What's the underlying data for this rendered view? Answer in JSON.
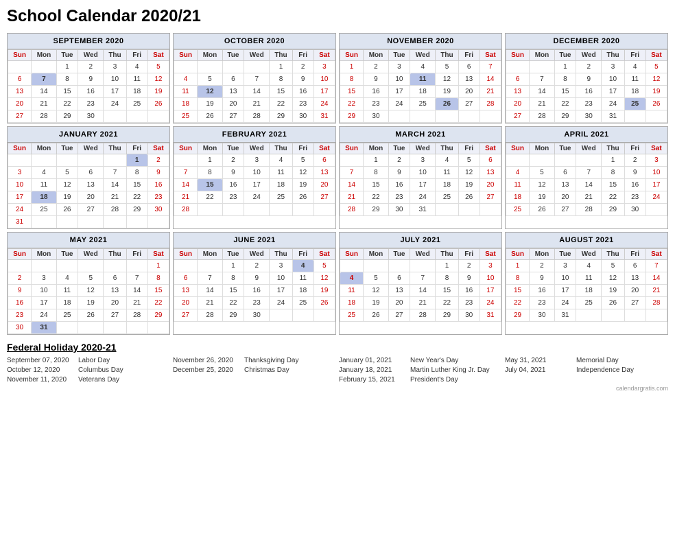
{
  "title": "School Calendar 2020/21",
  "months": [
    {
      "name": "SEPTEMBER 2020",
      "days": [
        "Sun",
        "Mon",
        "Tue",
        "Wed",
        "Thu",
        "Fri",
        "Sat"
      ],
      "weeks": [
        [
          "",
          "",
          "1",
          "2",
          "3",
          "4",
          "5"
        ],
        [
          "6",
          "7",
          "8",
          "9",
          "10",
          "11",
          "12"
        ],
        [
          "13",
          "14",
          "15",
          "16",
          "17",
          "18",
          "19"
        ],
        [
          "20",
          "21",
          "22",
          "23",
          "24",
          "25",
          "26"
        ],
        [
          "27",
          "28",
          "29",
          "30",
          "",
          "",
          ""
        ]
      ],
      "highlights": {
        "7": "blue"
      }
    },
    {
      "name": "OCTOBER 2020",
      "days": [
        "Sun",
        "Mon",
        "Tue",
        "Wed",
        "Thu",
        "Fri",
        "Sat"
      ],
      "weeks": [
        [
          "",
          "",
          "",
          "",
          "1",
          "2",
          "3"
        ],
        [
          "4",
          "5",
          "6",
          "7",
          "8",
          "9",
          "10"
        ],
        [
          "11",
          "12",
          "13",
          "14",
          "15",
          "16",
          "17"
        ],
        [
          "18",
          "19",
          "20",
          "21",
          "22",
          "23",
          "24"
        ],
        [
          "25",
          "26",
          "27",
          "28",
          "29",
          "30",
          "31"
        ]
      ],
      "highlights": {
        "12": "blue"
      }
    },
    {
      "name": "NOVEMBER 2020",
      "days": [
        "Sun",
        "Mon",
        "Tue",
        "Wed",
        "Thu",
        "Fri",
        "Sat"
      ],
      "weeks": [
        [
          "1",
          "2",
          "3",
          "4",
          "5",
          "6",
          "7"
        ],
        [
          "8",
          "9",
          "10",
          "11",
          "12",
          "13",
          "14"
        ],
        [
          "15",
          "16",
          "17",
          "18",
          "19",
          "20",
          "21"
        ],
        [
          "22",
          "23",
          "24",
          "25",
          "26",
          "27",
          "28"
        ],
        [
          "29",
          "30",
          "",
          "",
          "",
          "",
          ""
        ]
      ],
      "highlights": {
        "11": "blue",
        "26": "blue"
      }
    },
    {
      "name": "DECEMBER 2020",
      "days": [
        "Sun",
        "Mon",
        "Tue",
        "Wed",
        "Thu",
        "Fri",
        "Sat"
      ],
      "weeks": [
        [
          "",
          "",
          "1",
          "2",
          "3",
          "4",
          "5"
        ],
        [
          "6",
          "7",
          "8",
          "9",
          "10",
          "11",
          "12"
        ],
        [
          "13",
          "14",
          "15",
          "16",
          "17",
          "18",
          "19"
        ],
        [
          "20",
          "21",
          "22",
          "23",
          "24",
          "25",
          "26"
        ],
        [
          "27",
          "28",
          "29",
          "30",
          "31",
          "",
          ""
        ]
      ],
      "highlights": {
        "25": "blue"
      }
    },
    {
      "name": "JANUARY 2021",
      "days": [
        "Sun",
        "Mon",
        "Tue",
        "Wed",
        "Thu",
        "Fri",
        "Sat"
      ],
      "weeks": [
        [
          "",
          "",
          "",
          "",
          "",
          "1",
          "2"
        ],
        [
          "3",
          "4",
          "5",
          "6",
          "7",
          "8",
          "9"
        ],
        [
          "10",
          "11",
          "12",
          "13",
          "14",
          "15",
          "16"
        ],
        [
          "17",
          "18",
          "19",
          "20",
          "21",
          "22",
          "23"
        ],
        [
          "24",
          "25",
          "26",
          "27",
          "28",
          "29",
          "30"
        ],
        [
          "31",
          "",
          "",
          "",
          "",
          "",
          ""
        ]
      ],
      "highlights": {
        "1": "blue",
        "18": "blue"
      }
    },
    {
      "name": "FEBRUARY 2021",
      "days": [
        "Sun",
        "Mon",
        "Tue",
        "Wed",
        "Thu",
        "Fri",
        "Sat"
      ],
      "weeks": [
        [
          "",
          "1",
          "2",
          "3",
          "4",
          "5",
          "6"
        ],
        [
          "7",
          "8",
          "9",
          "10",
          "11",
          "12",
          "13"
        ],
        [
          "14",
          "15",
          "16",
          "17",
          "18",
          "19",
          "20"
        ],
        [
          "21",
          "22",
          "23",
          "24",
          "25",
          "26",
          "27"
        ],
        [
          "28",
          "",
          "",
          "",
          "",
          "",
          ""
        ]
      ],
      "highlights": {
        "15": "blue"
      }
    },
    {
      "name": "MARCH 2021",
      "days": [
        "Sun",
        "Mon",
        "Tue",
        "Wed",
        "Thu",
        "Fri",
        "Sat"
      ],
      "weeks": [
        [
          "",
          "1",
          "2",
          "3",
          "4",
          "5",
          "6"
        ],
        [
          "7",
          "8",
          "9",
          "10",
          "11",
          "12",
          "13"
        ],
        [
          "14",
          "15",
          "16",
          "17",
          "18",
          "19",
          "20"
        ],
        [
          "21",
          "22",
          "23",
          "24",
          "25",
          "26",
          "27"
        ],
        [
          "28",
          "29",
          "30",
          "31",
          "",
          "",
          ""
        ]
      ],
      "highlights": {}
    },
    {
      "name": "APRIL 2021",
      "days": [
        "Sun",
        "Mon",
        "Tue",
        "Wed",
        "Thu",
        "Fri",
        "Sat"
      ],
      "weeks": [
        [
          "",
          "",
          "",
          "",
          "1",
          "2",
          "3"
        ],
        [
          "4",
          "5",
          "6",
          "7",
          "8",
          "9",
          "10"
        ],
        [
          "11",
          "12",
          "13",
          "14",
          "15",
          "16",
          "17"
        ],
        [
          "18",
          "19",
          "20",
          "21",
          "22",
          "23",
          "24"
        ],
        [
          "25",
          "26",
          "27",
          "28",
          "29",
          "30",
          ""
        ]
      ],
      "highlights": {}
    },
    {
      "name": "MAY 2021",
      "days": [
        "Sun",
        "Mon",
        "Tue",
        "Wed",
        "Thu",
        "Fri",
        "Sat"
      ],
      "weeks": [
        [
          "",
          "",
          "",
          "",
          "",
          "",
          "1"
        ],
        [
          "2",
          "3",
          "4",
          "5",
          "6",
          "7",
          "8"
        ],
        [
          "9",
          "10",
          "11",
          "12",
          "13",
          "14",
          "15"
        ],
        [
          "16",
          "17",
          "18",
          "19",
          "20",
          "21",
          "22"
        ],
        [
          "23",
          "24",
          "25",
          "26",
          "27",
          "28",
          "29"
        ],
        [
          "30",
          "31",
          "",
          "",
          "",
          "",
          ""
        ]
      ],
      "highlights": {
        "31": "blue"
      }
    },
    {
      "name": "JUNE 2021",
      "days": [
        "Sun",
        "Mon",
        "Tue",
        "Wed",
        "Thu",
        "Fri",
        "Sat"
      ],
      "weeks": [
        [
          "",
          "",
          "1",
          "2",
          "3",
          "4",
          "5"
        ],
        [
          "6",
          "7",
          "8",
          "9",
          "10",
          "11",
          "12"
        ],
        [
          "13",
          "14",
          "15",
          "16",
          "17",
          "18",
          "19"
        ],
        [
          "20",
          "21",
          "22",
          "23",
          "24",
          "25",
          "26"
        ],
        [
          "27",
          "28",
          "29",
          "30",
          "",
          "",
          ""
        ]
      ],
      "highlights": {
        "4": "blue"
      }
    },
    {
      "name": "JULY 2021",
      "days": [
        "Sun",
        "Mon",
        "Tue",
        "Wed",
        "Thu",
        "Fri",
        "Sat"
      ],
      "weeks": [
        [
          "",
          "",
          "",
          "",
          "1",
          "2",
          "3"
        ],
        [
          "4",
          "5",
          "6",
          "7",
          "8",
          "9",
          "10"
        ],
        [
          "11",
          "12",
          "13",
          "14",
          "15",
          "16",
          "17"
        ],
        [
          "18",
          "19",
          "20",
          "21",
          "22",
          "23",
          "24"
        ],
        [
          "25",
          "26",
          "27",
          "28",
          "29",
          "30",
          "31"
        ]
      ],
      "highlights": {
        "4": "blue"
      }
    },
    {
      "name": "AUGUST 2021",
      "days": [
        "Sun",
        "Mon",
        "Tue",
        "Wed",
        "Thu",
        "Fri",
        "Sat"
      ],
      "weeks": [
        [
          "1",
          "2",
          "3",
          "4",
          "5",
          "6",
          "7"
        ],
        [
          "8",
          "9",
          "10",
          "11",
          "12",
          "13",
          "14"
        ],
        [
          "15",
          "16",
          "17",
          "18",
          "19",
          "20",
          "21"
        ],
        [
          "22",
          "23",
          "24",
          "25",
          "26",
          "27",
          "28"
        ],
        [
          "29",
          "30",
          "31",
          "",
          "",
          "",
          ""
        ]
      ],
      "highlights": {}
    }
  ],
  "holidays_header": "Federal Holiday 2020-21",
  "holiday_columns": [
    [
      {
        "date": "September 07, 2020",
        "name": "Labor Day"
      },
      {
        "date": "October 12, 2020",
        "name": "Columbus Day"
      },
      {
        "date": "November 11, 2020",
        "name": "Veterans Day"
      }
    ],
    [
      {
        "date": "November 26, 2020",
        "name": "Thanksgiving Day"
      },
      {
        "date": "December 25, 2020",
        "name": "Christmas Day"
      }
    ],
    [
      {
        "date": "January 01, 2021",
        "name": "New Year's Day"
      },
      {
        "date": "January 18, 2021",
        "name": "Martin Luther King Jr. Day"
      },
      {
        "date": "February 15, 2021",
        "name": "President's Day"
      }
    ],
    [
      {
        "date": "May 31, 2021",
        "name": "Memorial Day"
      },
      {
        "date": "July 04, 2021",
        "name": "Independence Day"
      }
    ]
  ],
  "watermark": "calendargratis.com"
}
